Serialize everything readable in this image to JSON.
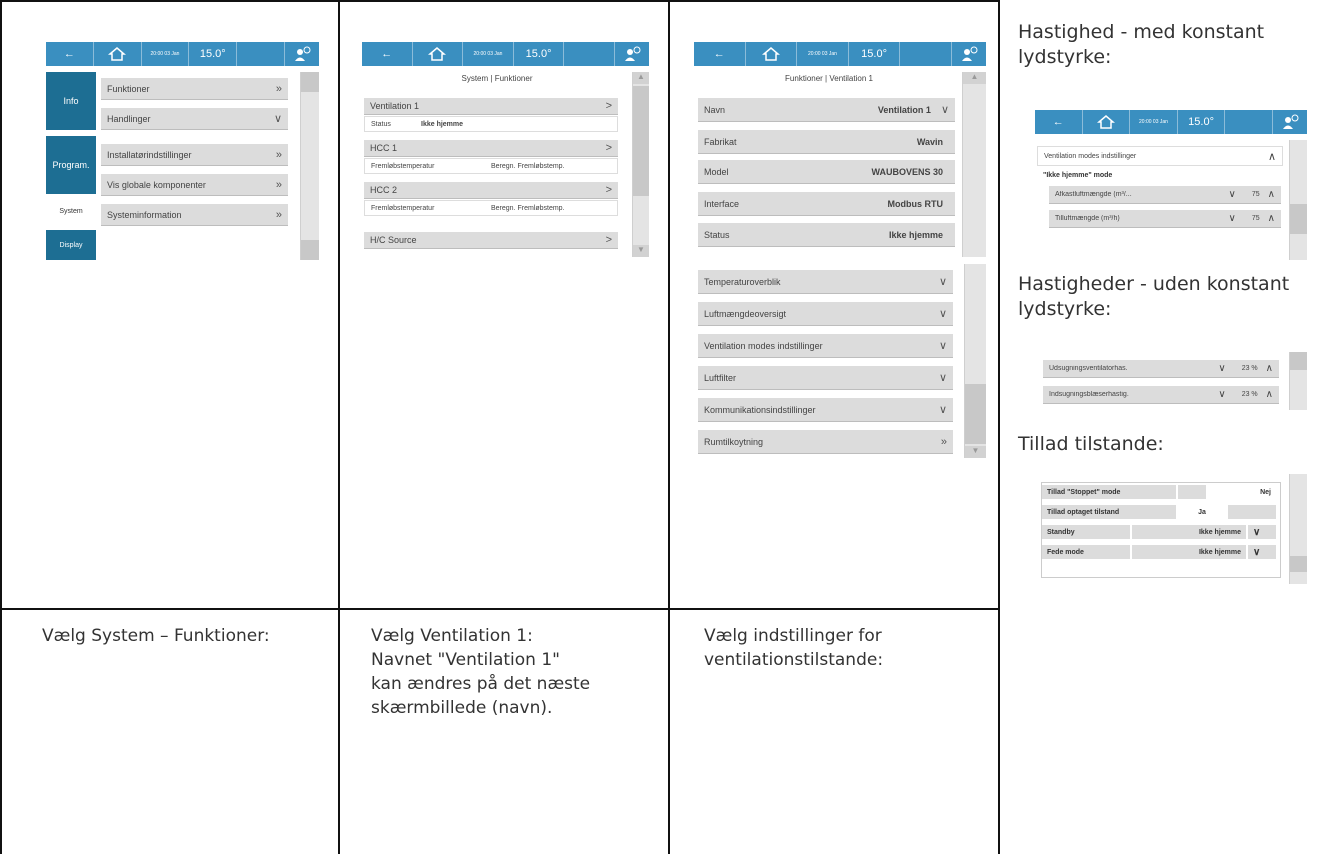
{
  "topbar": {
    "back": "←",
    "date": "20:00 03 Jan",
    "temp": "15.0°",
    "empty": "",
    "user": "⌂"
  },
  "shot1": {
    "left_menu": [
      "Info",
      "Program.",
      "System",
      "Display"
    ],
    "items": [
      {
        "label": "Funktioner",
        "icon": "»"
      },
      {
        "label": "Handlinger",
        "icon": "∨"
      },
      {
        "label": "Installatørindstillinger",
        "icon": "»"
      },
      {
        "label": "Vis globale komponenter",
        "icon": "»"
      },
      {
        "label": "Systeminformation",
        "icon": "»"
      }
    ]
  },
  "shot2": {
    "header": "System | Funktioner",
    "groups": [
      {
        "title": "Ventilation 1",
        "row_label": "Status",
        "row_value": "Ikke hjemme"
      },
      {
        "title": "HCC 1",
        "row_label": "Fremløbstemperatur",
        "row_value": "Beregn. Fremløbstemp."
      },
      {
        "title": "HCC 2",
        "row_label": "Fremløbstemperatur",
        "row_value": "Beregn. Fremløbstemp."
      },
      {
        "title": "H/C Source",
        "row_label": "",
        "row_value": ""
      }
    ]
  },
  "shot3": {
    "header": "Funktioner | Ventilation 1",
    "fields": [
      {
        "label": "Navn",
        "value": "Ventilation 1",
        "icon": "∨"
      },
      {
        "label": "Fabrikat",
        "value": "Wavin",
        "icon": ""
      },
      {
        "label": "Model",
        "value": "WAUBOVENS 30",
        "icon": ""
      },
      {
        "label": "Interface",
        "value": "Modbus RTU",
        "icon": ""
      },
      {
        "label": "Status",
        "value": "Ikke hjemme",
        "icon": ""
      }
    ],
    "sections": [
      {
        "label": "Temperaturoverblik",
        "icon": "∨"
      },
      {
        "label": "Luftmængdeoversigt",
        "icon": "∨"
      },
      {
        "label": "Ventilation modes indstillinger",
        "icon": "∨"
      },
      {
        "label": "Luftfilter",
        "icon": "∨"
      },
      {
        "label": "Kommunikationsindstillinger",
        "icon": "∨"
      },
      {
        "label": "Rumtilkoytning",
        "icon": "»"
      }
    ]
  },
  "captions": {
    "c1": "Vælg System – Funktioner:",
    "c2a": "Vælg Ventilation 1:",
    "c2b": "Navnet \"Ventilation 1\"",
    "c2c": "kan ændres på det næste",
    "c2d": "skærmbillede (navn).",
    "c3a": "Vælg indstillinger for",
    "c3b": "ventilationstilstande:"
  },
  "side": {
    "t1a": "Hastighed - med konstant",
    "t1b": "lydstyrke:",
    "t2a": "Hastigheder - uden konstant",
    "t2b": "lydstyrke:",
    "t3": "Tillad tilstande:",
    "panel1": {
      "section": "Ventilation modes indstillinger",
      "mode": "\"Ikke hjemme\" mode",
      "rows": [
        {
          "label": "Afkastluftmængde (m³/...",
          "value": "75"
        },
        {
          "label": "Tilluftmængde (m³/h)",
          "value": "75"
        }
      ]
    },
    "panel2": {
      "rows": [
        {
          "label": "Udsugningsventilatorhas.",
          "value": "23 %"
        },
        {
          "label": "Indsugningsblæserhastig.",
          "value": "23 %"
        }
      ]
    },
    "panel3": {
      "rows": [
        {
          "label": "Tillad \"Stoppet\" mode",
          "value": "Nej"
        },
        {
          "label": "Tillad optaget tilstand",
          "value": "Ja"
        },
        {
          "label": "Standby",
          "value": "Ikke hjemme"
        },
        {
          "label": "Fede mode",
          "value": "Ikke hjemme"
        }
      ]
    },
    "arrow_down": "∨",
    "arrow_up": "∧"
  }
}
